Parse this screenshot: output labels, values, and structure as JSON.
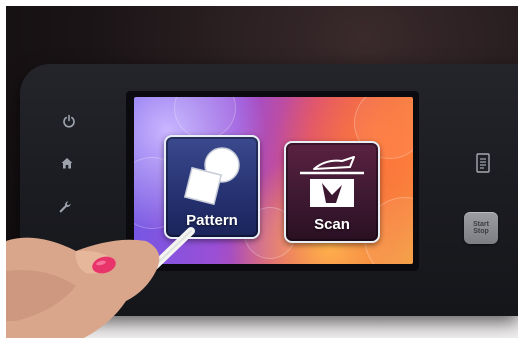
{
  "device_screen": {
    "tiles": [
      {
        "id": "pattern",
        "label": "Pattern"
      },
      {
        "id": "scan",
        "label": "Scan"
      }
    ]
  },
  "device_panel": {
    "left_buttons": [
      "power-icon",
      "home-icon",
      "wrench-icon"
    ],
    "right_icon": "document-icon",
    "start_stop_button": {
      "line1": "Start",
      "line2": "Stop"
    }
  },
  "colors": {
    "pattern_tile": "#253170",
    "scan_tile": "#3b1830",
    "screen_gradient_start": "#6c59e8",
    "screen_gradient_end": "#f39a3c",
    "nail_polish": "#e8336b"
  }
}
